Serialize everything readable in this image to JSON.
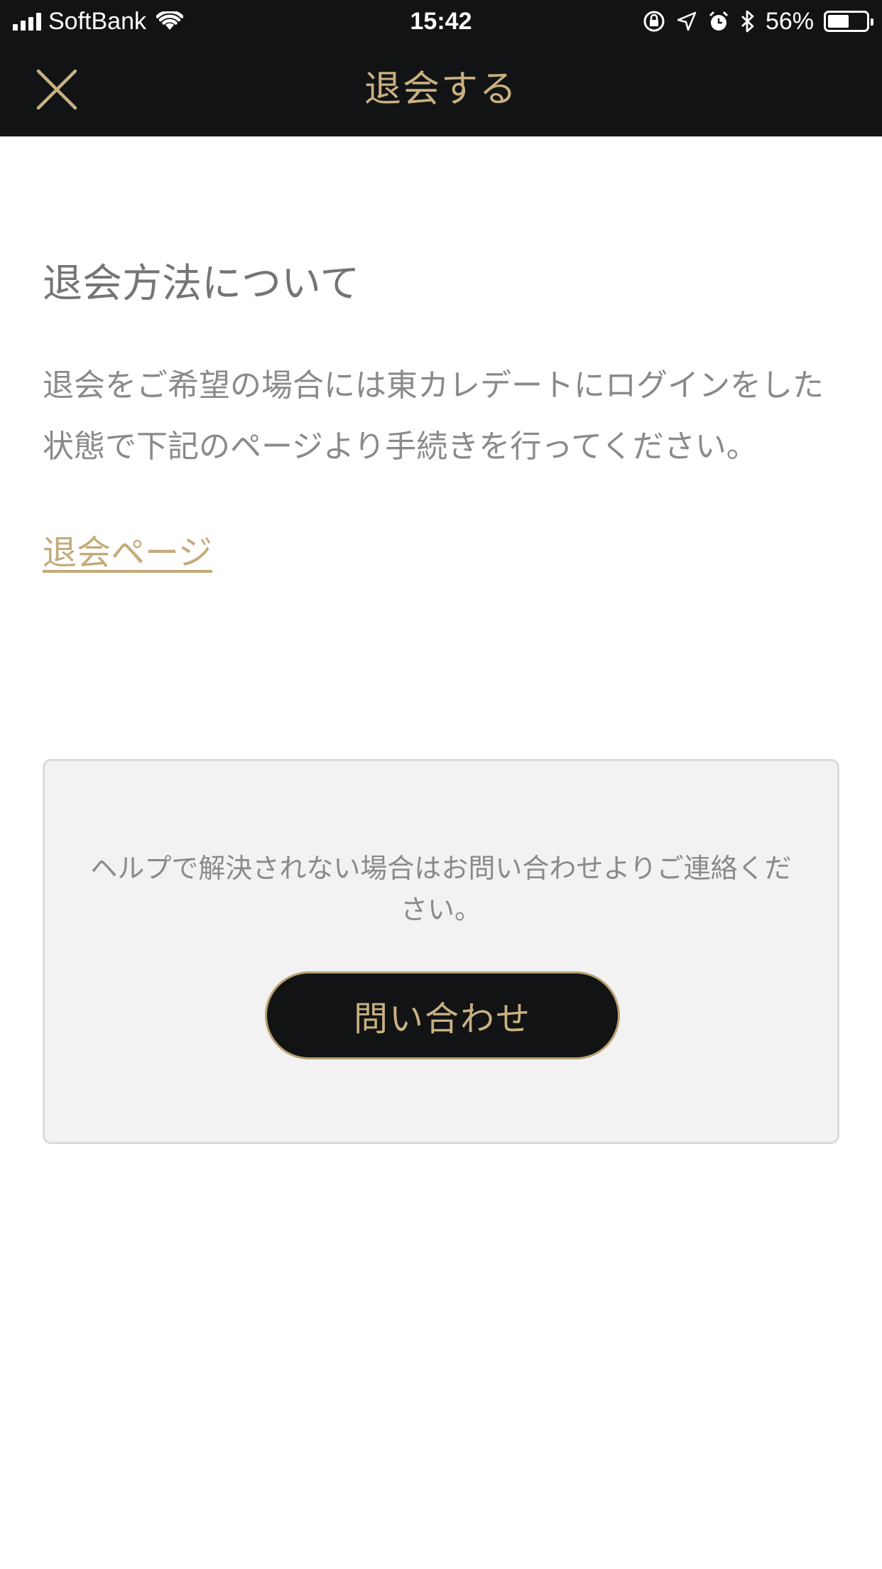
{
  "status_bar": {
    "carrier": "SoftBank",
    "time": "15:42",
    "battery_percent": "56%",
    "battery_level": 0.56,
    "icons": [
      "signal-icon",
      "wifi-icon",
      "orientation-lock-icon",
      "location-icon",
      "alarm-icon",
      "bluetooth-icon",
      "battery-icon"
    ]
  },
  "nav": {
    "title": "退会する",
    "close_icon": "close-icon"
  },
  "content": {
    "section_title": "退会方法について",
    "description": "退会をご希望の場合には東カレデートにログインをした状態で下記のページより手続きを行ってください。",
    "withdraw_link": "退会ページ"
  },
  "help": {
    "text": "ヘルプで解決されない場合はお問い合わせよりご連絡ください。",
    "contact_button": "問い合わせ"
  },
  "colors": {
    "header_bg": "#121314",
    "accent_gold": "#c9b182",
    "text_gray": "#8a8a8a",
    "help_box_bg": "#f2f2f2"
  }
}
